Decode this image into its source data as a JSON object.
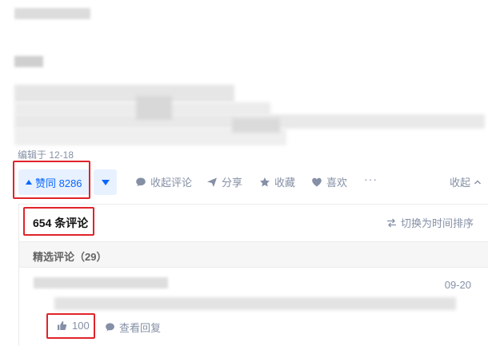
{
  "answer": {
    "edit_time": "编辑于 12-18"
  },
  "actions": {
    "vote_up": "赞同 8286",
    "collapse_comments": "收起评论",
    "share": "分享",
    "favorite": "收藏",
    "like": "喜欢",
    "more": "···",
    "collapse": "收起"
  },
  "comments": {
    "count": "654 条评论",
    "switch_sort": "切换为时间排序",
    "featured": "精选评论（29）",
    "items": [
      {
        "date": "09-20",
        "likes": "100",
        "view_replies": "查看回复"
      }
    ]
  },
  "colors": {
    "accent": "#0a66ff",
    "highlight": "#e0242a",
    "muted": "#8590a6"
  }
}
